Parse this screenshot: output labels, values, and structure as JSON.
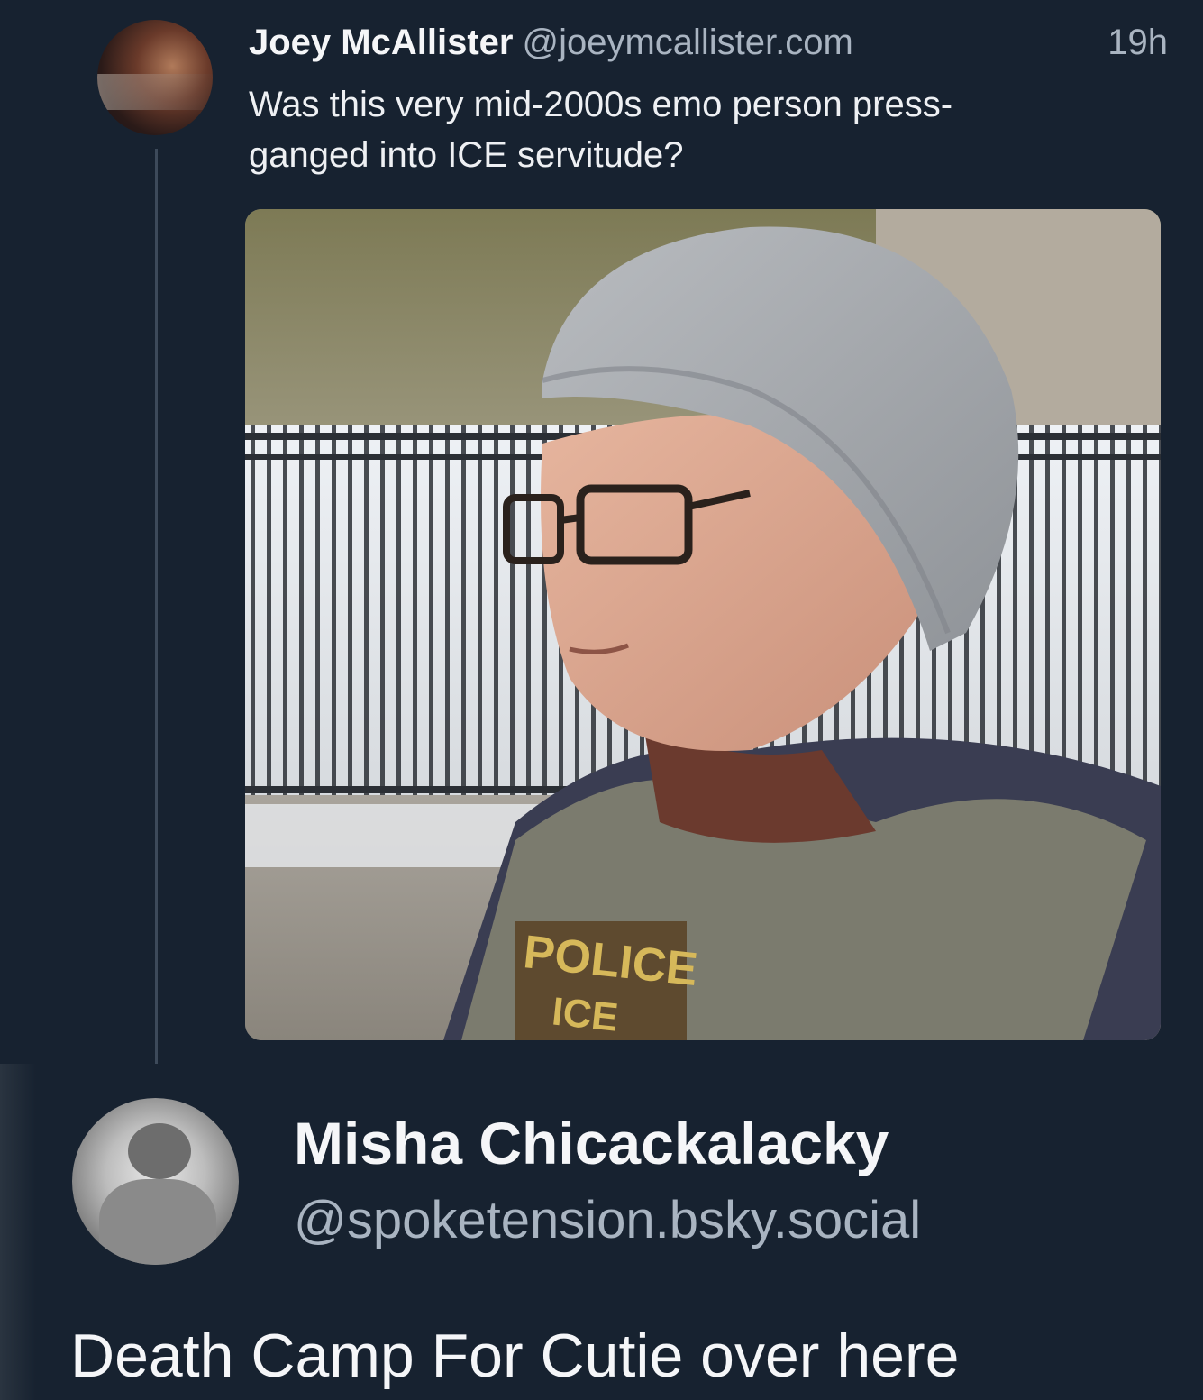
{
  "post1": {
    "display_name": "Joey McAllister",
    "handle": "@joeymcallister.com",
    "timestamp": "19h",
    "text": "Was this very mid-2000s emo person press-ganged into ICE servitude?",
    "image_vest_text_line1": "POLICE",
    "image_vest_text_line2": "ICE"
  },
  "post2": {
    "display_name": "Misha Chicackalacky",
    "handle": "@spoketension.bsky.social",
    "text": "Death Camp For Cutie over here"
  }
}
